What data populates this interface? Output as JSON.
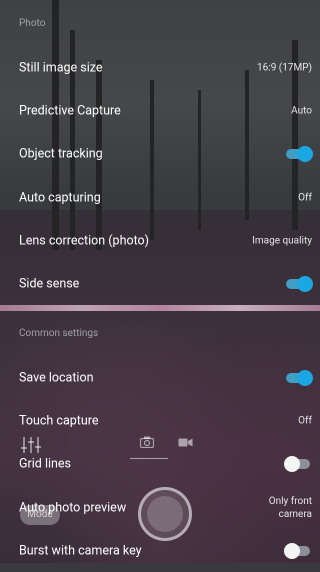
{
  "sections": {
    "photo": "Photo",
    "common": "Common settings"
  },
  "rows": [
    {
      "label": "Still image size",
      "value": "16:9 (17MP)"
    },
    {
      "label": "Predictive Capture",
      "value": "Auto"
    },
    {
      "label": "Object tracking",
      "toggle": "on"
    },
    {
      "label": "Auto capturing",
      "value": "Off"
    },
    {
      "label": "Lens correction (photo)",
      "value": "Image quality"
    },
    {
      "label": "Side sense",
      "toggle": "on"
    },
    {
      "label": "Save location",
      "toggle": "on"
    },
    {
      "label": "Touch capture",
      "value": "Off"
    },
    {
      "label": "Grid lines",
      "toggle": "off"
    },
    {
      "label": "Auto photo preview",
      "value_line1": "Only front",
      "value_line2": "camera"
    },
    {
      "label": "Burst with camera key",
      "toggle": "off"
    }
  ],
  "camera": {
    "mode_label": "Mode",
    "icons": [
      "adjust-icon",
      "photo-camera-icon",
      "video-camera-icon",
      "shutter-button"
    ]
  },
  "colors": {
    "toggle_on": "#1aa7e3",
    "toggle_off": "#f4f4f4",
    "text_primary": "#ffffff",
    "text_secondary": "#9ea3a6"
  }
}
